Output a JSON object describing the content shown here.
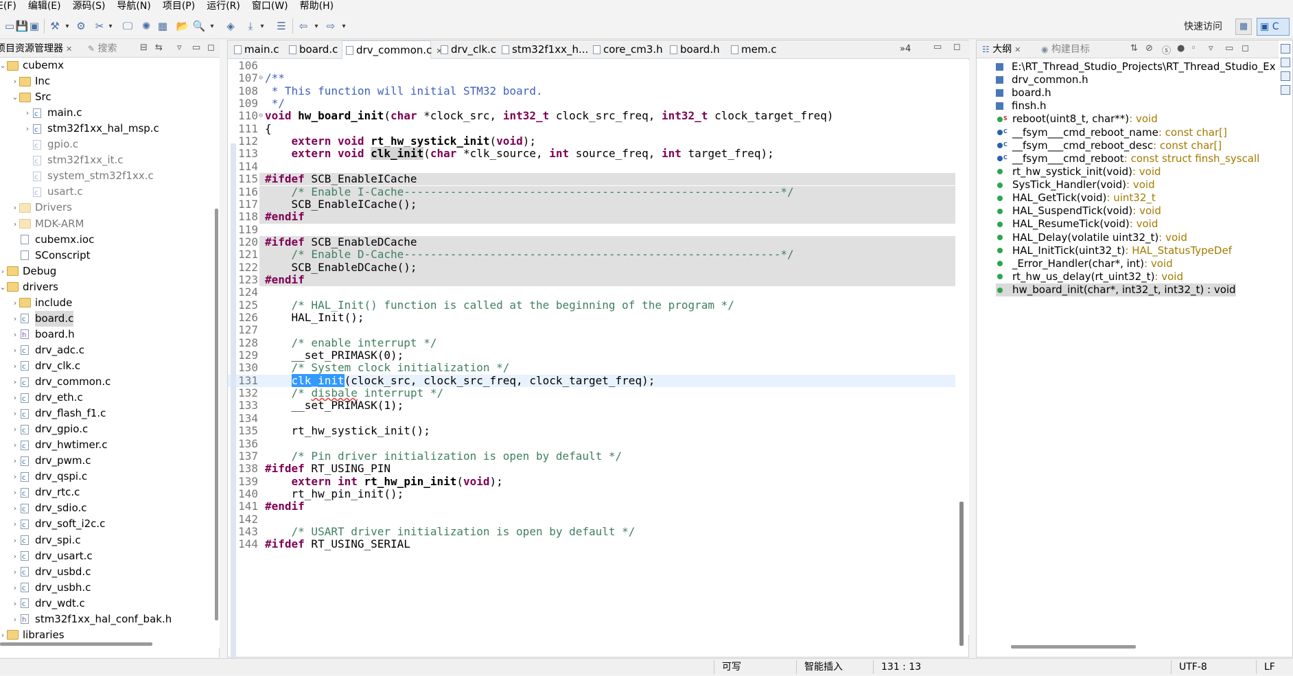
{
  "menu": [
    "E(F)",
    "编辑(E)",
    "源码(S)",
    "导航(N)",
    "项目(P)",
    "运行(R)",
    "窗口(W)",
    "帮助(H)"
  ],
  "toolbar": {
    "quick_access": "快速访问",
    "perspective_label": "C"
  },
  "left_panel": {
    "tabs": [
      "项目资源管理器",
      "搜索"
    ],
    "tree": [
      {
        "label": "cubemx",
        "indent": 0,
        "twisty": "v",
        "icon": "folder",
        "grey": false
      },
      {
        "label": "Inc",
        "indent": 1,
        "twisty": ">",
        "icon": "folder",
        "grey": false
      },
      {
        "label": "Src",
        "indent": 1,
        "twisty": "v",
        "icon": "folder",
        "grey": false
      },
      {
        "label": "main.c",
        "indent": 2,
        "twisty": ">",
        "icon": "cfile",
        "grey": false
      },
      {
        "label": "stm32f1xx_hal_msp.c",
        "indent": 2,
        "twisty": ">",
        "icon": "cfile",
        "grey": false
      },
      {
        "label": "gpio.c",
        "indent": 2,
        "twisty": "",
        "icon": "cfile",
        "grey": true
      },
      {
        "label": "stm32f1xx_it.c",
        "indent": 2,
        "twisty": "",
        "icon": "cfile",
        "grey": true
      },
      {
        "label": "system_stm32f1xx.c",
        "indent": 2,
        "twisty": "",
        "icon": "cfile",
        "grey": true
      },
      {
        "label": "usart.c",
        "indent": 2,
        "twisty": "",
        "icon": "cfile",
        "grey": true
      },
      {
        "label": "Drivers",
        "indent": 1,
        "twisty": ">",
        "icon": "folder",
        "grey": true
      },
      {
        "label": "MDK-ARM",
        "indent": 1,
        "twisty": ">",
        "icon": "folder",
        "grey": true
      },
      {
        "label": "cubemx.ioc",
        "indent": 1,
        "twisty": "",
        "icon": "file",
        "grey": false
      },
      {
        "label": "SConscript",
        "indent": 1,
        "twisty": "",
        "icon": "file",
        "grey": false
      },
      {
        "label": "Debug",
        "indent": 0,
        "twisty": ">",
        "icon": "folder",
        "grey": false
      },
      {
        "label": "drivers",
        "indent": 0,
        "twisty": "v",
        "icon": "folder",
        "grey": false
      },
      {
        "label": "include",
        "indent": 1,
        "twisty": ">",
        "icon": "folder",
        "grey": false
      },
      {
        "label": "board.c",
        "indent": 1,
        "twisty": ">",
        "icon": "cfile",
        "grey": false,
        "selected": true
      },
      {
        "label": "board.h",
        "indent": 1,
        "twisty": ">",
        "icon": "hfile",
        "grey": false
      },
      {
        "label": "drv_adc.c",
        "indent": 1,
        "twisty": ">",
        "icon": "cfile",
        "grey": false
      },
      {
        "label": "drv_clk.c",
        "indent": 1,
        "twisty": ">",
        "icon": "cfile",
        "grey": false
      },
      {
        "label": "drv_common.c",
        "indent": 1,
        "twisty": ">",
        "icon": "cfile",
        "grey": false
      },
      {
        "label": "drv_eth.c",
        "indent": 1,
        "twisty": ">",
        "icon": "cfile",
        "grey": false
      },
      {
        "label": "drv_flash_f1.c",
        "indent": 1,
        "twisty": ">",
        "icon": "cfile",
        "grey": false
      },
      {
        "label": "drv_gpio.c",
        "indent": 1,
        "twisty": ">",
        "icon": "cfile",
        "grey": false
      },
      {
        "label": "drv_hwtimer.c",
        "indent": 1,
        "twisty": ">",
        "icon": "cfile",
        "grey": false
      },
      {
        "label": "drv_pwm.c",
        "indent": 1,
        "twisty": ">",
        "icon": "cfile",
        "grey": false
      },
      {
        "label": "drv_qspi.c",
        "indent": 1,
        "twisty": ">",
        "icon": "cfile",
        "grey": false
      },
      {
        "label": "drv_rtc.c",
        "indent": 1,
        "twisty": ">",
        "icon": "cfile",
        "grey": false
      },
      {
        "label": "drv_sdio.c",
        "indent": 1,
        "twisty": ">",
        "icon": "cfile",
        "grey": false
      },
      {
        "label": "drv_soft_i2c.c",
        "indent": 1,
        "twisty": ">",
        "icon": "cfile",
        "grey": false
      },
      {
        "label": "drv_spi.c",
        "indent": 1,
        "twisty": ">",
        "icon": "cfile",
        "grey": false
      },
      {
        "label": "drv_usart.c",
        "indent": 1,
        "twisty": ">",
        "icon": "cfile",
        "grey": false
      },
      {
        "label": "drv_usbd.c",
        "indent": 1,
        "twisty": ">",
        "icon": "cfile",
        "grey": false
      },
      {
        "label": "drv_usbh.c",
        "indent": 1,
        "twisty": ">",
        "icon": "cfile",
        "grey": false
      },
      {
        "label": "drv_wdt.c",
        "indent": 1,
        "twisty": ">",
        "icon": "cfile",
        "grey": false
      },
      {
        "label": "stm32f1xx_hal_conf_bak.h",
        "indent": 1,
        "twisty": ">",
        "icon": "hfile",
        "grey": false
      },
      {
        "label": "libraries",
        "indent": 0,
        "twisty": ">",
        "icon": "folder",
        "grey": false
      }
    ]
  },
  "editor": {
    "tabs": [
      {
        "label": "main.c",
        "active": false
      },
      {
        "label": "board.c",
        "active": false
      },
      {
        "label": "drv_common.c",
        "active": true
      },
      {
        "label": "drv_clk.c",
        "active": false
      },
      {
        "label": "stm32f1xx_h...",
        "active": false
      },
      {
        "label": "core_cm3.h",
        "active": false
      },
      {
        "label": "board.h",
        "active": false
      },
      {
        "label": "mem.c",
        "active": false
      }
    ],
    "overflow": "»4",
    "lines": [
      {
        "n": "106",
        "html": ""
      },
      {
        "n": "107",
        "fold": true,
        "html": "<span class=\"cm\">/**</span>"
      },
      {
        "n": "108",
        "html": "<span class=\"cm\"> * This function will initial STM32 board.</span>"
      },
      {
        "n": "109",
        "html": "<span class=\"cm\"> */</span>"
      },
      {
        "n": "110",
        "fold": true,
        "html": "<span class=\"kw\">void</span> <span class=\"fn\">hw_board_init</span>(<span class=\"kw\">char</span> *clock_src, <span class=\"kw\">int32_t</span> clock_src_freq, <span class=\"kw\">int32_t</span> clock_target_freq)"
      },
      {
        "n": "111",
        "html": "{"
      },
      {
        "n": "112",
        "html": "    <span class=\"kw\">extern</span> <span class=\"kw\">void</span> <span class=\"fn\">rt_hw_systick_init</span>(<span class=\"kw\">void</span>);"
      },
      {
        "n": "113",
        "html": "    <span class=\"kw\">extern</span> <span class=\"kw\">void</span> <span class=\"fn hl\">clk_init</span>(<span class=\"kw\">char</span> *clk_source, <span class=\"kw\">int</span> source_freq, <span class=\"kw\">int</span> target_freq);"
      },
      {
        "n": "114",
        "html": ""
      },
      {
        "n": "115",
        "shaded": true,
        "html": "<span class=\"kw\">#ifdef</span> SCB_EnableICache"
      },
      {
        "n": "116",
        "shaded": true,
        "html": "    <span class=\"cmt\">/* Enable I-Cache---------------------------------------------------------*/</span>"
      },
      {
        "n": "117",
        "shaded": true,
        "html": "    SCB_EnableICache();"
      },
      {
        "n": "118",
        "shaded": true,
        "html": "<span class=\"kw\">#endif</span>"
      },
      {
        "n": "119",
        "html": ""
      },
      {
        "n": "120",
        "shaded": true,
        "html": "<span class=\"kw\">#ifdef</span> SCB_EnableDCache"
      },
      {
        "n": "121",
        "shaded": true,
        "html": "    <span class=\"cmt\">/* Enable D-Cache---------------------------------------------------------*/</span>"
      },
      {
        "n": "122",
        "shaded": true,
        "html": "    SCB_EnableDCache();"
      },
      {
        "n": "123",
        "shaded": true,
        "html": "<span class=\"kw\">#endif</span>"
      },
      {
        "n": "124",
        "html": ""
      },
      {
        "n": "125",
        "html": "    <span class=\"cmt\">/* HAL_Init() function is called at the beginning of the program */</span>"
      },
      {
        "n": "126",
        "html": "    HAL_Init();"
      },
      {
        "n": "127",
        "html": ""
      },
      {
        "n": "128",
        "html": "    <span class=\"cmt\">/* enable interrupt */</span>"
      },
      {
        "n": "129",
        "html": "    __set_PRIMASK(0);"
      },
      {
        "n": "130",
        "html": "    <span class=\"cmt\">/* System clock initialization */</span>"
      },
      {
        "n": "131",
        "current": true,
        "html": "    <span class=\"sel\">clk_init</span>(clock_src, clock_src_freq, clock_target_freq);"
      },
      {
        "n": "132",
        "html": "    <span class=\"cmt\">/* <span class=\"squig\">disbale</span> interrupt */</span>"
      },
      {
        "n": "133",
        "html": "    __set_PRIMASK(1);"
      },
      {
        "n": "134",
        "html": ""
      },
      {
        "n": "135",
        "html": "    rt_hw_systick_init();"
      },
      {
        "n": "136",
        "html": ""
      },
      {
        "n": "137",
        "html": "    <span class=\"cmt\">/* Pin driver initialization is open by default */</span>"
      },
      {
        "n": "138",
        "html": "<span class=\"kw\">#ifdef</span> RT_USING_PIN"
      },
      {
        "n": "139",
        "html": "    <span class=\"kw\">extern</span> <span class=\"kw\">int</span> <span class=\"fn\">rt_hw_pin_init</span>(<span class=\"kw\">void</span>);"
      },
      {
        "n": "140",
        "html": "    rt_hw_pin_init();"
      },
      {
        "n": "141",
        "html": "<span class=\"kw\">#endif</span>"
      },
      {
        "n": "142",
        "html": ""
      },
      {
        "n": "143",
        "html": "    <span class=\"cmt\">/* USART driver initialization is open by default */</span>"
      },
      {
        "n": "144",
        "html": "<span class=\"kw\">#ifdef</span> RT_USING_SERIAL"
      }
    ]
  },
  "right_panel": {
    "tabs": [
      "大纲",
      "构建目标"
    ],
    "outline": [
      {
        "icon": "inc",
        "name": "E:\\RT_Thread_Studio_Projects\\RT_Thread_Studio_Ex",
        "type": ""
      },
      {
        "icon": "inc",
        "name": "drv_common.h",
        "type": ""
      },
      {
        "icon": "inc",
        "name": "board.h",
        "type": ""
      },
      {
        "icon": "inc",
        "name": "finsh.h",
        "type": ""
      },
      {
        "icon": "dot-s",
        "name": "reboot(uint8_t, char**)",
        "type": " : void"
      },
      {
        "icon": "dotb-c",
        "name": "__fsym___cmd_reboot_name",
        "type": " : const char[]"
      },
      {
        "icon": "dotb-c",
        "name": "__fsym___cmd_reboot_desc",
        "type": " : const char[]"
      },
      {
        "icon": "dotb-c",
        "name": "__fsym___cmd_reboot",
        "type": " : const struct finsh_syscall"
      },
      {
        "icon": "dot",
        "name": "rt_hw_systick_init(void)",
        "type": " : void"
      },
      {
        "icon": "dot",
        "name": "SysTick_Handler(void)",
        "type": " : void"
      },
      {
        "icon": "dot",
        "name": "HAL_GetTick(void)",
        "type": " : uint32_t"
      },
      {
        "icon": "dot",
        "name": "HAL_SuspendTick(void)",
        "type": " : void"
      },
      {
        "icon": "dot",
        "name": "HAL_ResumeTick(void)",
        "type": " : void"
      },
      {
        "icon": "dot",
        "name": "HAL_Delay(volatile uint32_t)",
        "type": " : void"
      },
      {
        "icon": "dot",
        "name": "HAL_InitTick(uint32_t)",
        "type": " : HAL_StatusTypeDef"
      },
      {
        "icon": "dot",
        "name": "_Error_Handler(char*, int)",
        "type": " : void"
      },
      {
        "icon": "dot",
        "name": "rt_hw_us_delay(rt_uint32_t)",
        "type": " : void"
      },
      {
        "icon": "dot",
        "name": "hw_board_init(char*, int32_t, int32_t) : void",
        "type": "",
        "selected": true
      }
    ]
  },
  "status": {
    "writable": "可写",
    "insert_mode": "智能插入",
    "position": "131 : 13",
    "encoding": "UTF-8",
    "line_ending": "LF"
  }
}
